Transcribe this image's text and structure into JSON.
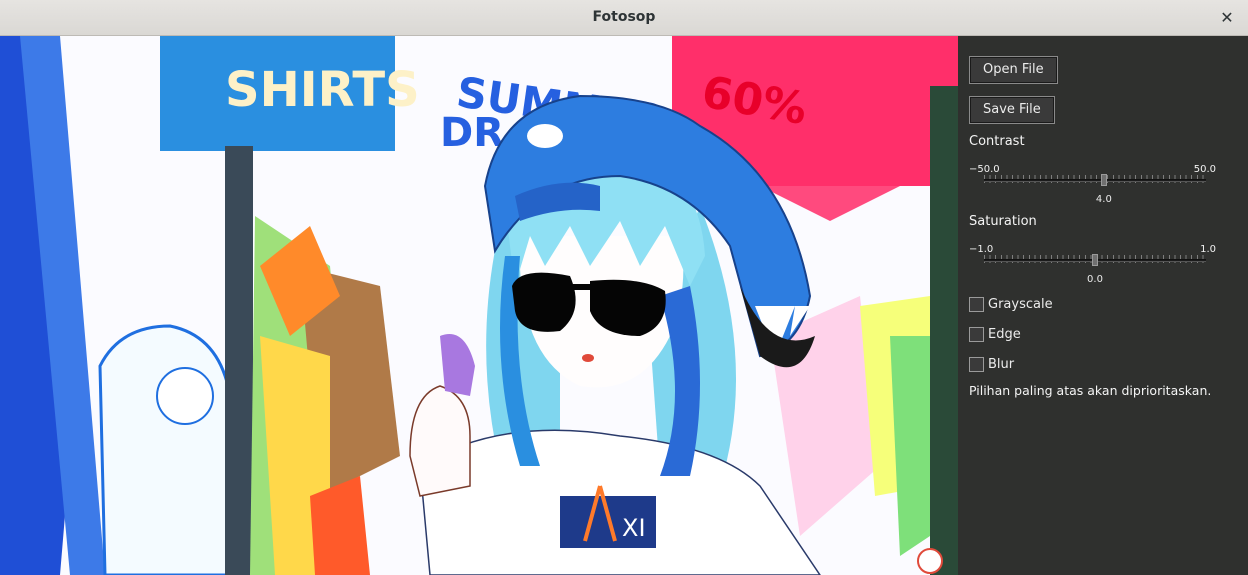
{
  "window": {
    "title": "Fotosop",
    "close_glyph": "✕"
  },
  "image": {
    "description_icon": "image-canvas",
    "sign_text_left": "SHIRTS",
    "sign_text_top": "SUMMER",
    "sign_text_top2": "DR",
    "sign_text_percent": "60%",
    "shirt_text": "XI"
  },
  "panel": {
    "open_label": "Open File",
    "save_label": "Save File",
    "contrast": {
      "label": "Contrast",
      "min": "−50.0",
      "max": "50.0",
      "value": "4.0",
      "fraction": 0.54
    },
    "saturation": {
      "label": "Saturation",
      "min": "−1.0",
      "max": "1.0",
      "value": "0.0",
      "fraction": 0.5
    },
    "options": [
      {
        "label": "Grayscale",
        "checked": false
      },
      {
        "label": "Edge",
        "checked": false
      },
      {
        "label": "Blur",
        "checked": false
      }
    ],
    "note": "Pilihan paling atas akan diprioritaskan."
  },
  "colors": {
    "panel_bg": "#2f302e",
    "titlebar_bg": "#e0deda",
    "hat_blue": "#2d7de0",
    "hair_blue": "#7fd6ef"
  }
}
